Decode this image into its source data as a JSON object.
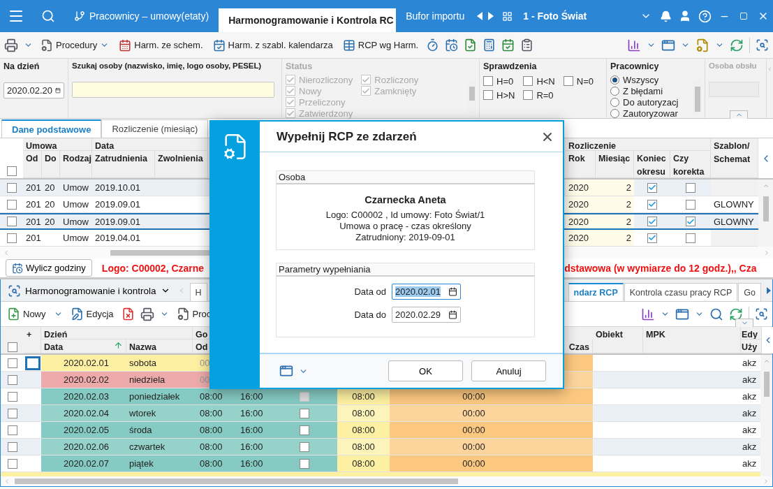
{
  "titlebar": {
    "tabs": [
      {
        "label": "Pracownicy – umowy(etaty)",
        "selected": false
      },
      {
        "label": "Harmonogramowanie i Kontrola RC",
        "selected": true
      },
      {
        "label": "Bufor importu",
        "selected": false
      }
    ],
    "company": "1 - Foto Świat"
  },
  "toolbar": {
    "buttons": [
      {
        "label": "Procedury",
        "kind": "procedures"
      },
      {
        "label": "Harm. ze schem.",
        "kind": "schedule"
      },
      {
        "label": "Harm. z szabl. kalendarza",
        "kind": "template"
      },
      {
        "label": "RCP wg Harm.",
        "kind": "rcp"
      }
    ]
  },
  "filters": {
    "date_label": "Na dzień",
    "date": "2020.02.20",
    "search_label": "Szukaj osoby (nazwisko, imię, logo osoby, PESEL)",
    "status": {
      "label": "Status",
      "disabled": true,
      "options": [
        {
          "label": "Nierozliczony",
          "checked": true
        },
        {
          "label": "Nowy",
          "checked": true
        },
        {
          "label": "Przeliczony",
          "checked": true
        },
        {
          "label": "Zatwierdzony",
          "checked": true
        },
        {
          "label": "Rozliczony",
          "checked": true
        },
        {
          "label": "Zamknięty",
          "checked": true
        }
      ]
    },
    "checks": {
      "label": "Sprawdzenia",
      "options": [
        {
          "label": "H=0",
          "checked": false
        },
        {
          "label": "H<N",
          "checked": false
        },
        {
          "label": "N=0",
          "checked": false
        },
        {
          "label": "H>N",
          "checked": false
        },
        {
          "label": "R=0",
          "checked": false
        }
      ]
    },
    "employees": {
      "label": "Pracownicy",
      "options": [
        {
          "label": "Wszyscy",
          "selected": true
        },
        {
          "label": "Z błędami",
          "selected": false
        },
        {
          "label": "Do autoryzacj",
          "selected": false
        },
        {
          "label": "Zautoryzowar",
          "selected": false
        }
      ]
    },
    "handler": {
      "label": "Osoba obsłu",
      "disabled": true
    }
  },
  "upper": {
    "tabs": [
      {
        "label": "Dane podstawowe",
        "selected": true
      },
      {
        "label": "Rozliczenie (miesiąc)",
        "selected": false
      }
    ],
    "groups": [
      "Umowa",
      "Data",
      "Rozliczenie"
    ],
    "columns": [
      "Od",
      "Do",
      "Rodzaj",
      "Zatrudnienia",
      "Zwolnienia",
      "Rok",
      "Miesiąc",
      "Koniec okresu",
      "Czy korekta"
    ],
    "template_header": "Szablon/ Schemat",
    "rows": [
      {
        "od": "201",
        "do": "20",
        "type": "Umow",
        "hired": "2019.10.01",
        "year": "2020",
        "month": "2",
        "period_end": true,
        "correction": false,
        "selected": false,
        "checked": false
      },
      {
        "od": "201",
        "do": "20",
        "type": "Umow",
        "hired": "2019.09.01",
        "year": "2020",
        "month": "2",
        "period_end": true,
        "correction": false,
        "template": "GLOWNY",
        "selected": false,
        "checked": false
      },
      {
        "od": "201",
        "do": "20",
        "type": "Umow",
        "hired": "2019.09.01",
        "year": "2020",
        "month": "2",
        "period_end": true,
        "correction": true,
        "template": "GLOWNY",
        "selected": true,
        "checked": false
      },
      {
        "od": "201",
        "type": "Umow",
        "hired": "2019.04.01",
        "year": "2020",
        "month": "2",
        "period_end": true,
        "correction": false,
        "selected": false,
        "checked": false
      }
    ],
    "compute_button": "Wylicz godziny",
    "message_left": "Logo: C00002, Czarne",
    "message_right": "dstawowa (w wymiarze do 12 godz.),, Cza",
    "select_all": false
  },
  "lower": {
    "module": "Harmonogramowanie i kontrola",
    "select_all": false,
    "tabs": [
      {
        "label": "H",
        "selected": false
      },
      {
        "label": "ndarz RCP",
        "selected": true
      },
      {
        "label": "Kontrola czasu pracy RCP",
        "selected": false
      },
      {
        "label": "Go",
        "selected": false
      }
    ],
    "toolbar": [
      "Nowy",
      "Edycja",
      "Proc"
    ],
    "header": {
      "plus": "+",
      "day": "Dzień",
      "hours": "Go",
      "date": "Data",
      "name": "Nazwa",
      "from": "Od",
      "time": "Czas",
      "object": "Obiekt",
      "mpk": "MPK",
      "edit": "Edy",
      "user": "Uży"
    },
    "rows": [
      {
        "date": "2020.02.01",
        "day": "sobota",
        "from": "00",
        "user": "akz",
        "color": "#fdf0a2",
        "focused": true,
        "checked": false
      },
      {
        "date": "2020.02.02",
        "day": "niedziela",
        "from": "00",
        "user": "akz",
        "color": "#eeaaaa",
        "focused": false,
        "checked": false
      },
      {
        "date": "2020.02.03",
        "day": "poniedziałek",
        "from": "08:00",
        "to": "16:00",
        "mark_disabled": true,
        "planned": "08:00",
        "time": "00:00",
        "user": "akz",
        "color": "#85cbc3",
        "focused": false,
        "checked": false
      },
      {
        "date": "2020.02.04",
        "day": "wtorek",
        "from": "08:00",
        "to": "16:00",
        "mark_disabled": false,
        "planned": "08:00",
        "time": "00:00",
        "user": "akz",
        "color": "#95d2ca",
        "focused": false,
        "checked": false
      },
      {
        "date": "2020.02.05",
        "day": "środa",
        "from": "08:00",
        "to": "16:00",
        "mark_disabled": false,
        "planned": "08:00",
        "time": "00:00",
        "user": "akz",
        "color": "#85cbc3",
        "focused": false,
        "checked": false
      },
      {
        "date": "2020.02.06",
        "day": "czwartek",
        "from": "08:00",
        "to": "16:00",
        "mark_disabled": false,
        "planned": "08:00",
        "time": "00:00",
        "user": "akz",
        "color": "#95d2ca",
        "focused": false,
        "checked": false
      },
      {
        "date": "2020.02.07",
        "day": "piątek",
        "from": "08:00",
        "to": "16:00",
        "mark_disabled": false,
        "planned": "08:00",
        "time": "00:00",
        "user": "akz",
        "color": "#85cbc3",
        "focused": false,
        "checked": false
      }
    ]
  },
  "dialog": {
    "title": "Wypełnij RCP ze zdarzeń",
    "person_group": "Osoba",
    "name": "Czarnecka Aneta",
    "details": [
      "Logo: C00002 , Id umowy: Foto Świat/1",
      "Umowa o pracę - czas określony",
      "Zatrudniony: 2019-09-01"
    ],
    "params_group": "Parametry wypełniania",
    "fields": [
      {
        "label": "Data od",
        "value": "2020.02.01",
        "selected": true
      },
      {
        "label": "Data do",
        "value": "2020.02.29",
        "selected": false
      }
    ],
    "buttons": [
      "OK",
      "Anuluj"
    ]
  }
}
